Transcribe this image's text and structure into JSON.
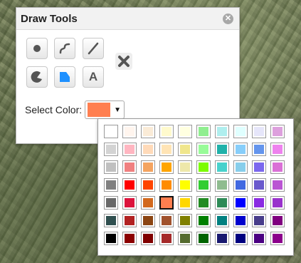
{
  "panel": {
    "title": "Draw Tools",
    "close_icon": "close-circle-icon",
    "select_color_label": "Select Color:",
    "selected_color": "#FF7F50"
  },
  "tools": [
    {
      "name": "point-tool-button",
      "icon": "point-icon"
    },
    {
      "name": "freehand-tool-button",
      "icon": "freehand-icon"
    },
    {
      "name": "line-tool-button",
      "icon": "line-icon"
    },
    {
      "name": "clear-button",
      "icon": "close-x-icon"
    },
    {
      "name": "freehand-polygon-tool-button",
      "icon": "freehand-polygon-icon"
    },
    {
      "name": "polygon-tool-button",
      "icon": "polygon-icon"
    },
    {
      "name": "text-tool-button",
      "icon": "text-icon",
      "label": "A"
    }
  ],
  "palette": {
    "selected_index": 43,
    "colors": [
      "#FFFFFF",
      "#FFF5EE",
      "#FAEBD7",
      "#FFFACD",
      "#FFFFE0",
      "#90EE90",
      "#AFEEEE",
      "#E0FFFF",
      "#E6E6FA",
      "#DDA0DD",
      "#D3D3D3",
      "#FFB6C1",
      "#FFDAB9",
      "#FFE4B5",
      "#F0E68C",
      "#98FB98",
      "#20B2AA",
      "#87CEFA",
      "#6495ED",
      "#EE82EE",
      "#C0C0C0",
      "#F08080",
      "#F4A460",
      "#FFA500",
      "#EEE8AA",
      "#7CFC00",
      "#48D1CC",
      "#87CEEB",
      "#7B68EE",
      "#DA70D6",
      "#808080",
      "#FF0000",
      "#FF4500",
      "#FF8C00",
      "#FFFF00",
      "#32CD32",
      "#8FBC8F",
      "#4169E1",
      "#6A5ACD",
      "#BA55D3",
      "#696969",
      "#DC143C",
      "#D2691E",
      "#FF7F50",
      "#FFD700",
      "#228B22",
      "#2E8B57",
      "#0000FF",
      "#8A2BE2",
      "#9932CC",
      "#2F4F4F",
      "#B22222",
      "#8B4513",
      "#A0522D",
      "#808000",
      "#008000",
      "#008080",
      "#0000CD",
      "#483D8B",
      "#800080",
      "#000000",
      "#8B0000",
      "#800000",
      "#A52A2A",
      "#556B2F",
      "#006400",
      "#191970",
      "#000080",
      "#4B0082",
      "#8B008B"
    ]
  }
}
